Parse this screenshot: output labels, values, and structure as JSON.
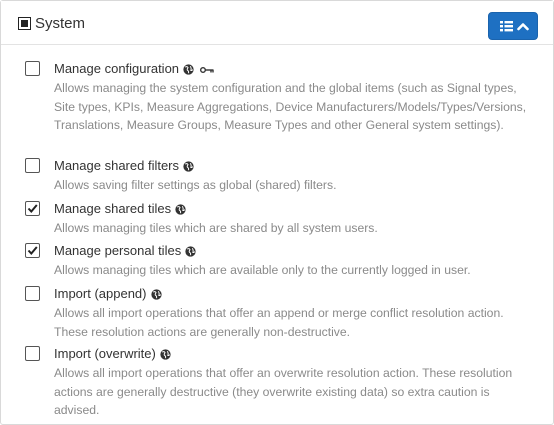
{
  "panel": {
    "title": "System",
    "group_checkbox_state": "indeterminate",
    "collapse_button": {
      "icons": [
        "list-icon",
        "chevron-up-icon"
      ],
      "color": "#1e70c2"
    }
  },
  "permissions": [
    {
      "label": "Manage configuration",
      "checked": false,
      "icons": [
        "globe-icon",
        "key-icon"
      ],
      "description": "Allows managing the system configuration and the global items (such as Signal types, Site types, KPIs, Measure Aggregations, Device Manufacturers/Models/Types/Versions, Translations, Measure Groups, Measure Types and other General system settings)."
    },
    {
      "label": "Manage shared filters",
      "checked": false,
      "icons": [
        "globe-icon"
      ],
      "description": "Allows saving filter settings as global (shared) filters."
    },
    {
      "label": "Manage shared tiles",
      "checked": true,
      "icons": [
        "globe-icon"
      ],
      "description": "Allows managing tiles which are shared by all system users."
    },
    {
      "label": "Manage personal tiles",
      "checked": true,
      "icons": [
        "globe-icon"
      ],
      "description": "Allows managing tiles which are available only to the currently logged in user."
    },
    {
      "label": "Import (append)",
      "checked": false,
      "icons": [
        "globe-icon"
      ],
      "description": "Allows all import operations that offer an append or merge conflict resolution action. These resolution actions are generally non-destructive."
    },
    {
      "label": "Import (overwrite)",
      "checked": false,
      "icons": [
        "globe-icon"
      ],
      "description": "Allows all import operations that offer an overwrite resolution action. These resolution actions are generally destructive (they overwrite existing data) so extra caution is advised."
    }
  ]
}
